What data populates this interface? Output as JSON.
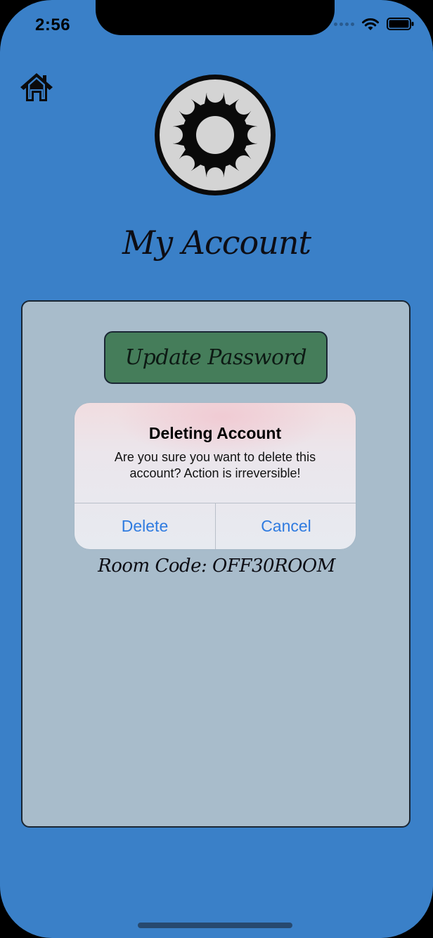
{
  "status_bar": {
    "time": "2:56",
    "icons": [
      "signal-dots-icon",
      "wifi-icon",
      "battery-icon"
    ]
  },
  "header": {
    "home_icon": "home-icon",
    "logo_icon": "gear-icon",
    "title": "My Account"
  },
  "card": {
    "update_password_label": "Update Password",
    "room_code": "Room Code: OFF30ROOM"
  },
  "alert": {
    "title": "Deleting Account",
    "message": "Are you sure you want to delete this account? Action is irreversible!",
    "delete_label": "Delete",
    "cancel_label": "Cancel"
  },
  "colors": {
    "background": "#3a80c8",
    "card": "#a8bccb",
    "update_button": "#457d5a",
    "alert_action": "#2f7be0"
  }
}
